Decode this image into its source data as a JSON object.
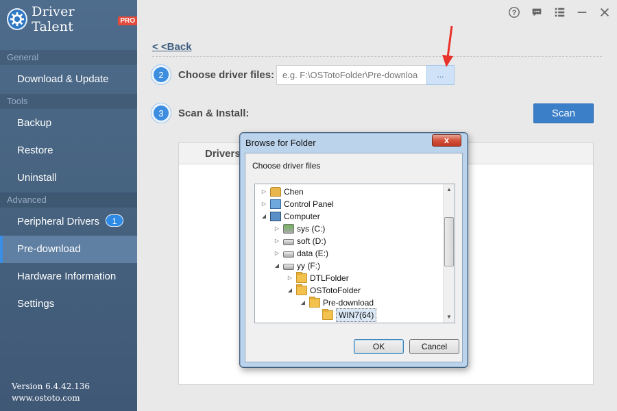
{
  "app": {
    "name": "Driver Talent",
    "pro_badge": "PRO"
  },
  "sidebar": {
    "sections": [
      {
        "label": "General"
      },
      {
        "label": "Tools"
      },
      {
        "label": "Advanced"
      }
    ],
    "items": [
      {
        "label": "Download & Update"
      },
      {
        "label": "Backup"
      },
      {
        "label": "Restore"
      },
      {
        "label": "Uninstall"
      },
      {
        "label": "Peripheral Drivers",
        "badge": "1"
      },
      {
        "label": "Pre-download",
        "active": true
      },
      {
        "label": "Hardware Information"
      },
      {
        "label": "Settings"
      }
    ],
    "version": "Version 6.4.42.136",
    "website": "www.ostoto.com"
  },
  "titlebar": {
    "icons": [
      "help-icon",
      "feedback-icon",
      "menu-icon",
      "minimize-icon",
      "close-icon"
    ]
  },
  "main": {
    "back_label": "< <Back",
    "step2": {
      "number": "2",
      "label": "Choose driver files:",
      "placeholder": "e.g. F:\\OSTotoFolder\\Pre-downloa",
      "browse_label": "..."
    },
    "step3": {
      "number": "3",
      "label": "Scan & Install:",
      "scan_label": "Scan"
    },
    "panel": {
      "header": "Drivers"
    }
  },
  "dialog": {
    "title": "Browse for Folder",
    "close_label": "x",
    "prompt": "Choose driver files",
    "tree": [
      {
        "label": "Chen",
        "expander": "▷",
        "icon": "user-folder-icon",
        "level": 0
      },
      {
        "label": "Control Panel",
        "expander": "▷",
        "icon": "control-panel-icon",
        "level": 0
      },
      {
        "label": "Computer",
        "expander": "◢",
        "icon": "computer-icon",
        "level": 0
      },
      {
        "label": "sys (C:)",
        "expander": "▷",
        "icon": "system-drive-icon",
        "level": 1
      },
      {
        "label": "soft (D:)",
        "expander": "▷",
        "icon": "drive-icon",
        "level": 1
      },
      {
        "label": "data (E:)",
        "expander": "▷",
        "icon": "drive-icon",
        "level": 1
      },
      {
        "label": "yy (F:)",
        "expander": "◢",
        "icon": "drive-icon",
        "level": 1
      },
      {
        "label": "DTLFolder",
        "expander": "▷",
        "icon": "folder-icon",
        "level": 2
      },
      {
        "label": "OSTotoFolder",
        "expander": "◢",
        "icon": "folder-icon",
        "level": 2
      },
      {
        "label": "Pre-download",
        "expander": "◢",
        "icon": "folder-icon",
        "level": 3
      },
      {
        "label": "WIN7(64)",
        "expander": "",
        "icon": "folder-icon",
        "level": 4,
        "selected": true
      }
    ],
    "ok_label": "OK",
    "cancel_label": "Cancel"
  },
  "colors": {
    "sidebar_bg": "#46627f",
    "accent": "#3b7fc9",
    "active_item": "#5f7fa3",
    "arrow": "#e8322b"
  }
}
